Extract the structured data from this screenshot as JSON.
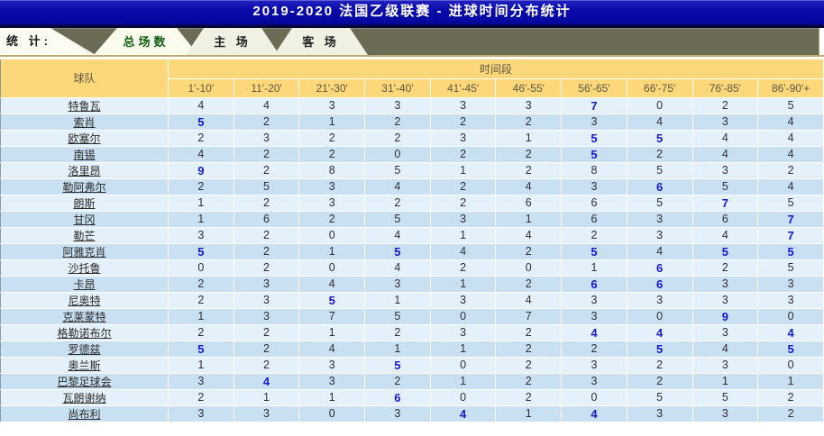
{
  "banner": {
    "title": "2019-2020 法国乙级联赛 - 进球时间分布统计"
  },
  "tabbar": {
    "label": "统 计:",
    "tabs": [
      {
        "label": "总场数",
        "active": true
      },
      {
        "label": "主 场",
        "active": false
      },
      {
        "label": "客 场",
        "active": false
      }
    ]
  },
  "table": {
    "team_header": "球队",
    "period_header": "时间段",
    "time_columns": [
      "1'-10'",
      "11'-20'",
      "21'-30'",
      "31'-40'",
      "41'-45'",
      "46'-55'",
      "56'-65'",
      "66'-75'",
      "76'-85'",
      "86'-90'+"
    ],
    "rows": [
      {
        "team": "特鲁瓦",
        "values": [
          4,
          4,
          3,
          3,
          3,
          3,
          7,
          0,
          2,
          5
        ]
      },
      {
        "team": "索肖",
        "values": [
          5,
          2,
          1,
          2,
          2,
          2,
          3,
          4,
          3,
          4
        ]
      },
      {
        "team": "欧塞尔",
        "values": [
          2,
          3,
          2,
          2,
          3,
          1,
          5,
          5,
          4,
          4
        ]
      },
      {
        "team": "南锡",
        "values": [
          4,
          2,
          2,
          0,
          2,
          2,
          5,
          2,
          4,
          4
        ]
      },
      {
        "team": "洛里昂",
        "values": [
          9,
          2,
          8,
          5,
          1,
          2,
          8,
          5,
          3,
          2
        ]
      },
      {
        "team": "勒阿弗尔",
        "values": [
          2,
          5,
          3,
          4,
          2,
          4,
          3,
          6,
          5,
          4
        ]
      },
      {
        "team": "朗斯",
        "values": [
          1,
          2,
          3,
          2,
          2,
          6,
          6,
          5,
          7,
          5
        ]
      },
      {
        "team": "甘冈",
        "values": [
          1,
          6,
          2,
          5,
          3,
          1,
          6,
          3,
          6,
          7
        ]
      },
      {
        "team": "勒芒",
        "values": [
          3,
          2,
          0,
          4,
          1,
          4,
          2,
          3,
          4,
          7
        ]
      },
      {
        "team": "阿雅克肖",
        "values": [
          5,
          2,
          1,
          5,
          4,
          2,
          5,
          4,
          5,
          5
        ]
      },
      {
        "team": "沙托鲁",
        "values": [
          0,
          2,
          0,
          4,
          2,
          0,
          1,
          6,
          2,
          5
        ]
      },
      {
        "team": "卡昂",
        "values": [
          2,
          3,
          4,
          3,
          1,
          2,
          6,
          6,
          3,
          3
        ]
      },
      {
        "team": "尼奥特",
        "values": [
          2,
          3,
          5,
          1,
          3,
          4,
          3,
          3,
          3,
          3
        ]
      },
      {
        "team": "克莱蒙特",
        "values": [
          1,
          3,
          7,
          5,
          0,
          7,
          3,
          0,
          9,
          0
        ]
      },
      {
        "team": "格勒诺布尔",
        "values": [
          2,
          2,
          1,
          2,
          3,
          2,
          4,
          4,
          3,
          4
        ]
      },
      {
        "team": "罗德兹",
        "values": [
          5,
          2,
          4,
          1,
          1,
          2,
          2,
          5,
          4,
          5
        ]
      },
      {
        "team": "奥兰斯",
        "values": [
          1,
          2,
          3,
          5,
          0,
          2,
          3,
          2,
          3,
          0
        ]
      },
      {
        "team": "巴黎足球会",
        "values": [
          3,
          4,
          3,
          2,
          1,
          2,
          3,
          2,
          1,
          1
        ]
      },
      {
        "team": "瓦朗谢纳",
        "values": [
          2,
          1,
          1,
          6,
          0,
          2,
          0,
          5,
          5,
          2
        ]
      },
      {
        "team": "尚布利",
        "values": [
          3,
          3,
          0,
          3,
          4,
          1,
          4,
          3,
          3,
          2
        ]
      }
    ]
  },
  "colors": {
    "banner_blue": "#0a0aa8",
    "header_yellow": "#fdd87b",
    "row_light": "#e4f1fa",
    "row_dark": "#c8e0f2",
    "max_value_blue": "#1717ce",
    "tab_olive": "#6c6c56",
    "active_tab_green": "#156015"
  }
}
